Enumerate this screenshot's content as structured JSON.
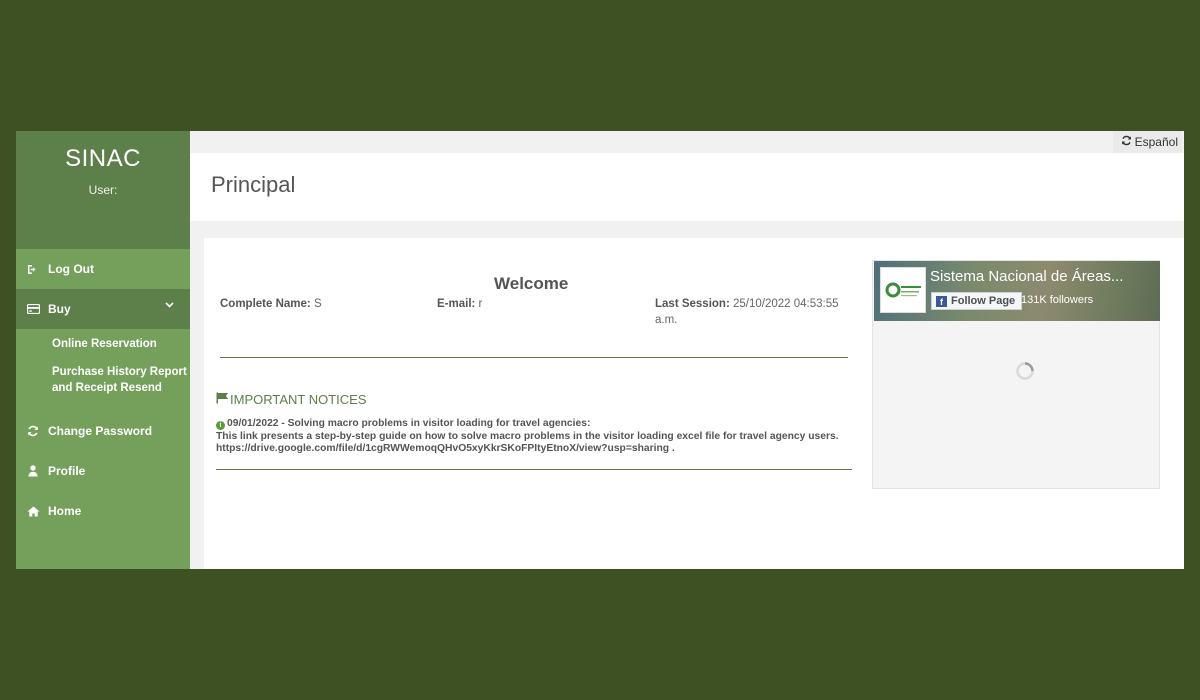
{
  "sidebar": {
    "brand": "SINAC",
    "user_label": "User:",
    "items": {
      "logout": "Log Out",
      "buy": "Buy",
      "online_reservation": "Online Reservation",
      "purchase_history": "Purchase History Report and Receipt Resend",
      "change_password": "Change Password",
      "profile": "Profile",
      "home": "Home"
    }
  },
  "topbar": {
    "language": "Español"
  },
  "header": {
    "title": "Principal"
  },
  "main": {
    "welcome": "Welcome",
    "complete_name_label": "Complete Name:",
    "complete_name_value": "S",
    "email_label": "E-mail:",
    "email_value": "r",
    "last_session_label": "Last Session:",
    "last_session_value": "25/10/2022 04:53:55 a.m.",
    "notices_title": "IMPORTANT NOTICES",
    "notice": {
      "headline": "09/01/2022 - Solving macro problems in visitor loading for travel agencies:",
      "body": "This link presents a step-by-step guide on how to solve macro problems in the visitor loading excel file for travel agency users.",
      "link": "https://drive.google.com/file/d/1cgRWWemoqQHvO5xyKkrSKoFPItyEtnoX/view?usp=sharing ."
    }
  },
  "facebook_widget": {
    "page_name": "Sistema Nacional de Áreas...",
    "follow_label": "Follow Page",
    "followers": "131K followers"
  },
  "colors": {
    "background": "#3d5122",
    "sidebar": "#74a05c",
    "sidebar_dark": "#5d7f49",
    "accent": "#5d7f49"
  },
  "icons": {
    "logout": "sign-out-icon",
    "buy": "credit-card-icon",
    "buy_expand": "chevron-down-icon",
    "change_password": "refresh-icon",
    "profile": "user-icon",
    "home": "home-icon",
    "language": "refresh-icon",
    "notices": "flag-icon",
    "notice_item": "info-circle-icon",
    "facebook": "facebook-icon",
    "loading": "spinner-icon"
  }
}
